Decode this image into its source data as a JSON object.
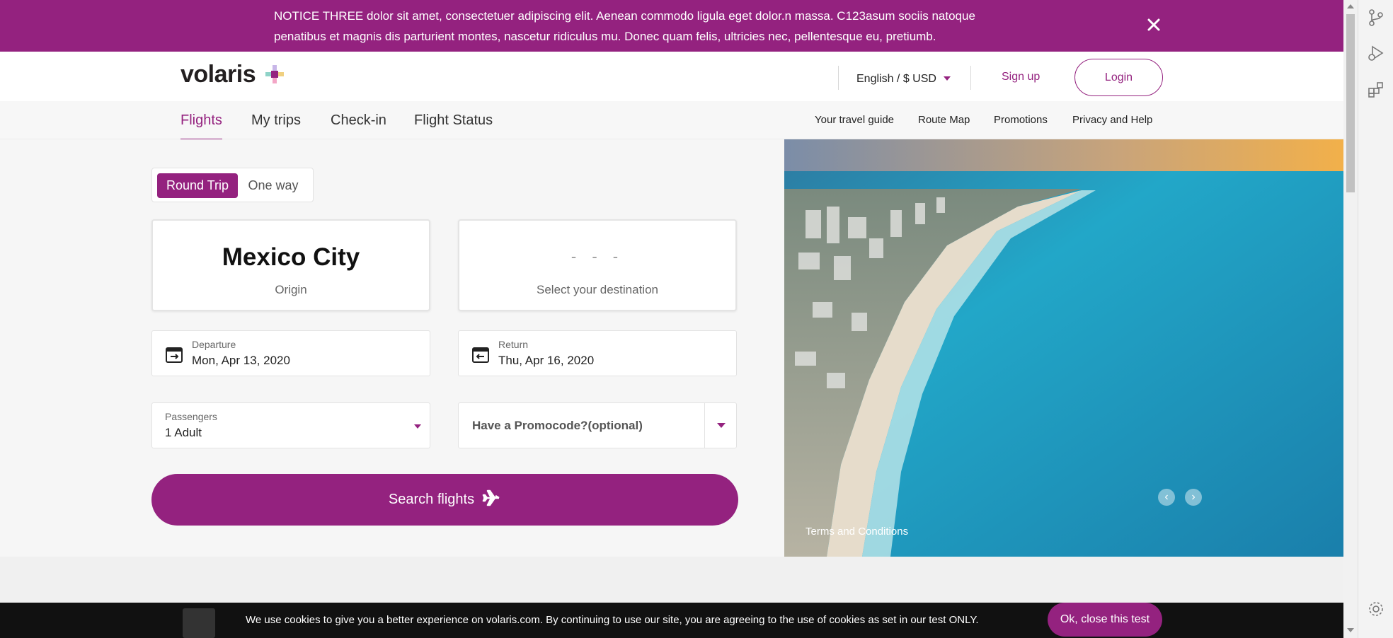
{
  "notice": {
    "text": "NOTICE THREE dolor sit amet, consectetuer adipiscing elit. Aenean commodo ligula eget dolor.n massa. C123asum sociis natoque penatibus et magnis dis parturient montes, nascetur ridiculus mu. Donec quam felis, ultricies nec, pellentesque eu, pretiumb.",
    "close_icon": "close-icon"
  },
  "header": {
    "logo_text": "volaris",
    "language": "English / $ USD",
    "signup": "Sign up",
    "login": "Login"
  },
  "nav": {
    "tabs": [
      {
        "label": "Flights",
        "active": true
      },
      {
        "label": "My trips",
        "active": false
      },
      {
        "label": "Check-in",
        "active": false
      },
      {
        "label": "Flight Status",
        "active": false
      }
    ],
    "links": [
      "Your travel guide",
      "Route Map",
      "Promotions",
      "Privacy and Help"
    ]
  },
  "search": {
    "trip_types": [
      "Round Trip",
      "One way"
    ],
    "selected_trip": "Round Trip",
    "origin": {
      "value": "Mexico City",
      "label": "Origin"
    },
    "destination": {
      "value": "- - -",
      "label": "Select your destination"
    },
    "departure": {
      "label": "Departure",
      "value": "Mon, Apr 13, 2020"
    },
    "return": {
      "label": "Return",
      "value": "Thu, Apr 16, 2020"
    },
    "passengers": {
      "label": "Passengers",
      "value": "1 Adult"
    },
    "promocode": {
      "placeholder": "Have a Promocode?(optional)"
    },
    "button": "Search flights"
  },
  "hero": {
    "terms": "Terms and Conditions",
    "prev": "‹",
    "next": "›"
  },
  "cookie": {
    "message": "We use cookies to give you a better experience on volaris.com. By continuing to use our site, you are agreeing to the use of cookies as set in our test ONLY.",
    "button": "Ok, close this test"
  },
  "colors": {
    "brand": "#94227f",
    "sea": "#1e9bbf",
    "sand": "#e6dccb"
  }
}
